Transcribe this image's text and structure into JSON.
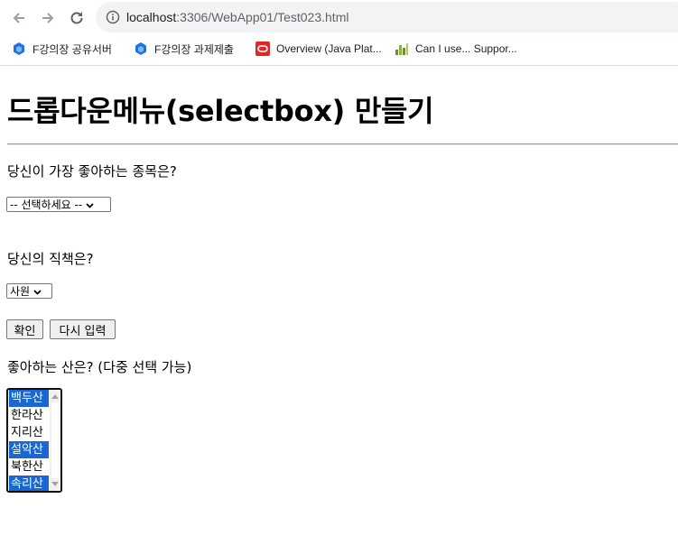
{
  "browser": {
    "url_host": "localhost",
    "url_rest": ":3306/WebApp01/Test023.html",
    "bookmarks": [
      {
        "label": "F강의장 공유서버",
        "icon": "cube-icon"
      },
      {
        "label": "F강의장 과제제출",
        "icon": "cube-icon"
      },
      {
        "label": "Overview (Java Plat...",
        "icon": "oracle-icon"
      },
      {
        "label": "Can I use... Suppor...",
        "icon": "caniuse-icon"
      }
    ]
  },
  "page": {
    "title": "드롭다운메뉴(selectbox) 만들기",
    "q1": {
      "label": "당신이 가장 좋아하는 종목은?",
      "selected": "-- 선택하세요 --"
    },
    "q2": {
      "label": "당신의 직책은?",
      "selected": "사원"
    },
    "buttons": {
      "confirm": "확인",
      "reset": "다시 입력"
    },
    "q3": {
      "label": "좋아하는 산은? (다중 선택 가능)",
      "options": [
        {
          "label": "백두산",
          "selected": true
        },
        {
          "label": "한라산",
          "selected": false
        },
        {
          "label": "지리산",
          "selected": false
        },
        {
          "label": "설악산",
          "selected": true
        },
        {
          "label": "북한산",
          "selected": false
        },
        {
          "label": "속리산",
          "selected": true
        }
      ]
    }
  },
  "colors": {
    "selection": "#1967d2",
    "omnibox": "#f1f3f4"
  }
}
